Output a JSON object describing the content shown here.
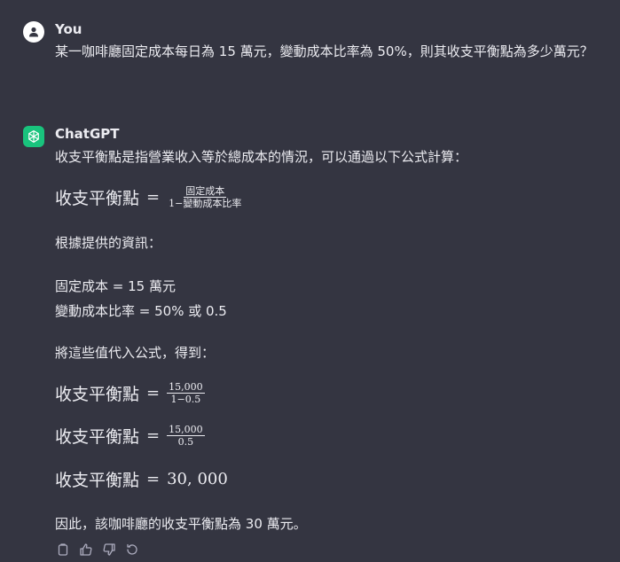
{
  "user": {
    "name": "You",
    "message": "某一咖啡廳固定成本每日為 15 萬元，變動成本比率為 50%，則其收支平衡點為多少萬元？"
  },
  "assistant": {
    "name": "ChatGPT",
    "intro": "收支平衡點是指營業收入等於總成本的情況，可以通過以下公式計算：",
    "formula1": {
      "lhs": "收支平衡點",
      "eq": "=",
      "numerator": "固定成本",
      "denominator": "1−變動成本比率"
    },
    "info_heading": "根據提供的資訊：",
    "info_line1": "固定成本 = 15 萬元",
    "info_line2": "變動成本比率 = 50% 或 0.5",
    "substitute": "將這些值代入公式，得到：",
    "formula2": {
      "lhs": "收支平衡點",
      "eq": "=",
      "numerator": "15,000",
      "denominator": "1−0.5"
    },
    "formula3": {
      "lhs": "收支平衡點",
      "eq": "=",
      "numerator": "15,000",
      "denominator": "0.5"
    },
    "formula4": {
      "lhs": "收支平衡點",
      "eq": "=",
      "result": "30, 000"
    },
    "conclusion": "因此，該咖啡廳的收支平衡點為 30 萬元。"
  },
  "actions": [
    "copy-icon",
    "thumbs-up-icon",
    "thumbs-down-icon",
    "regenerate-icon"
  ],
  "colors": {
    "background": "#343541",
    "text": "#ececf1",
    "gpt_avatar": "#19c37d",
    "icon": "#acacbe"
  }
}
